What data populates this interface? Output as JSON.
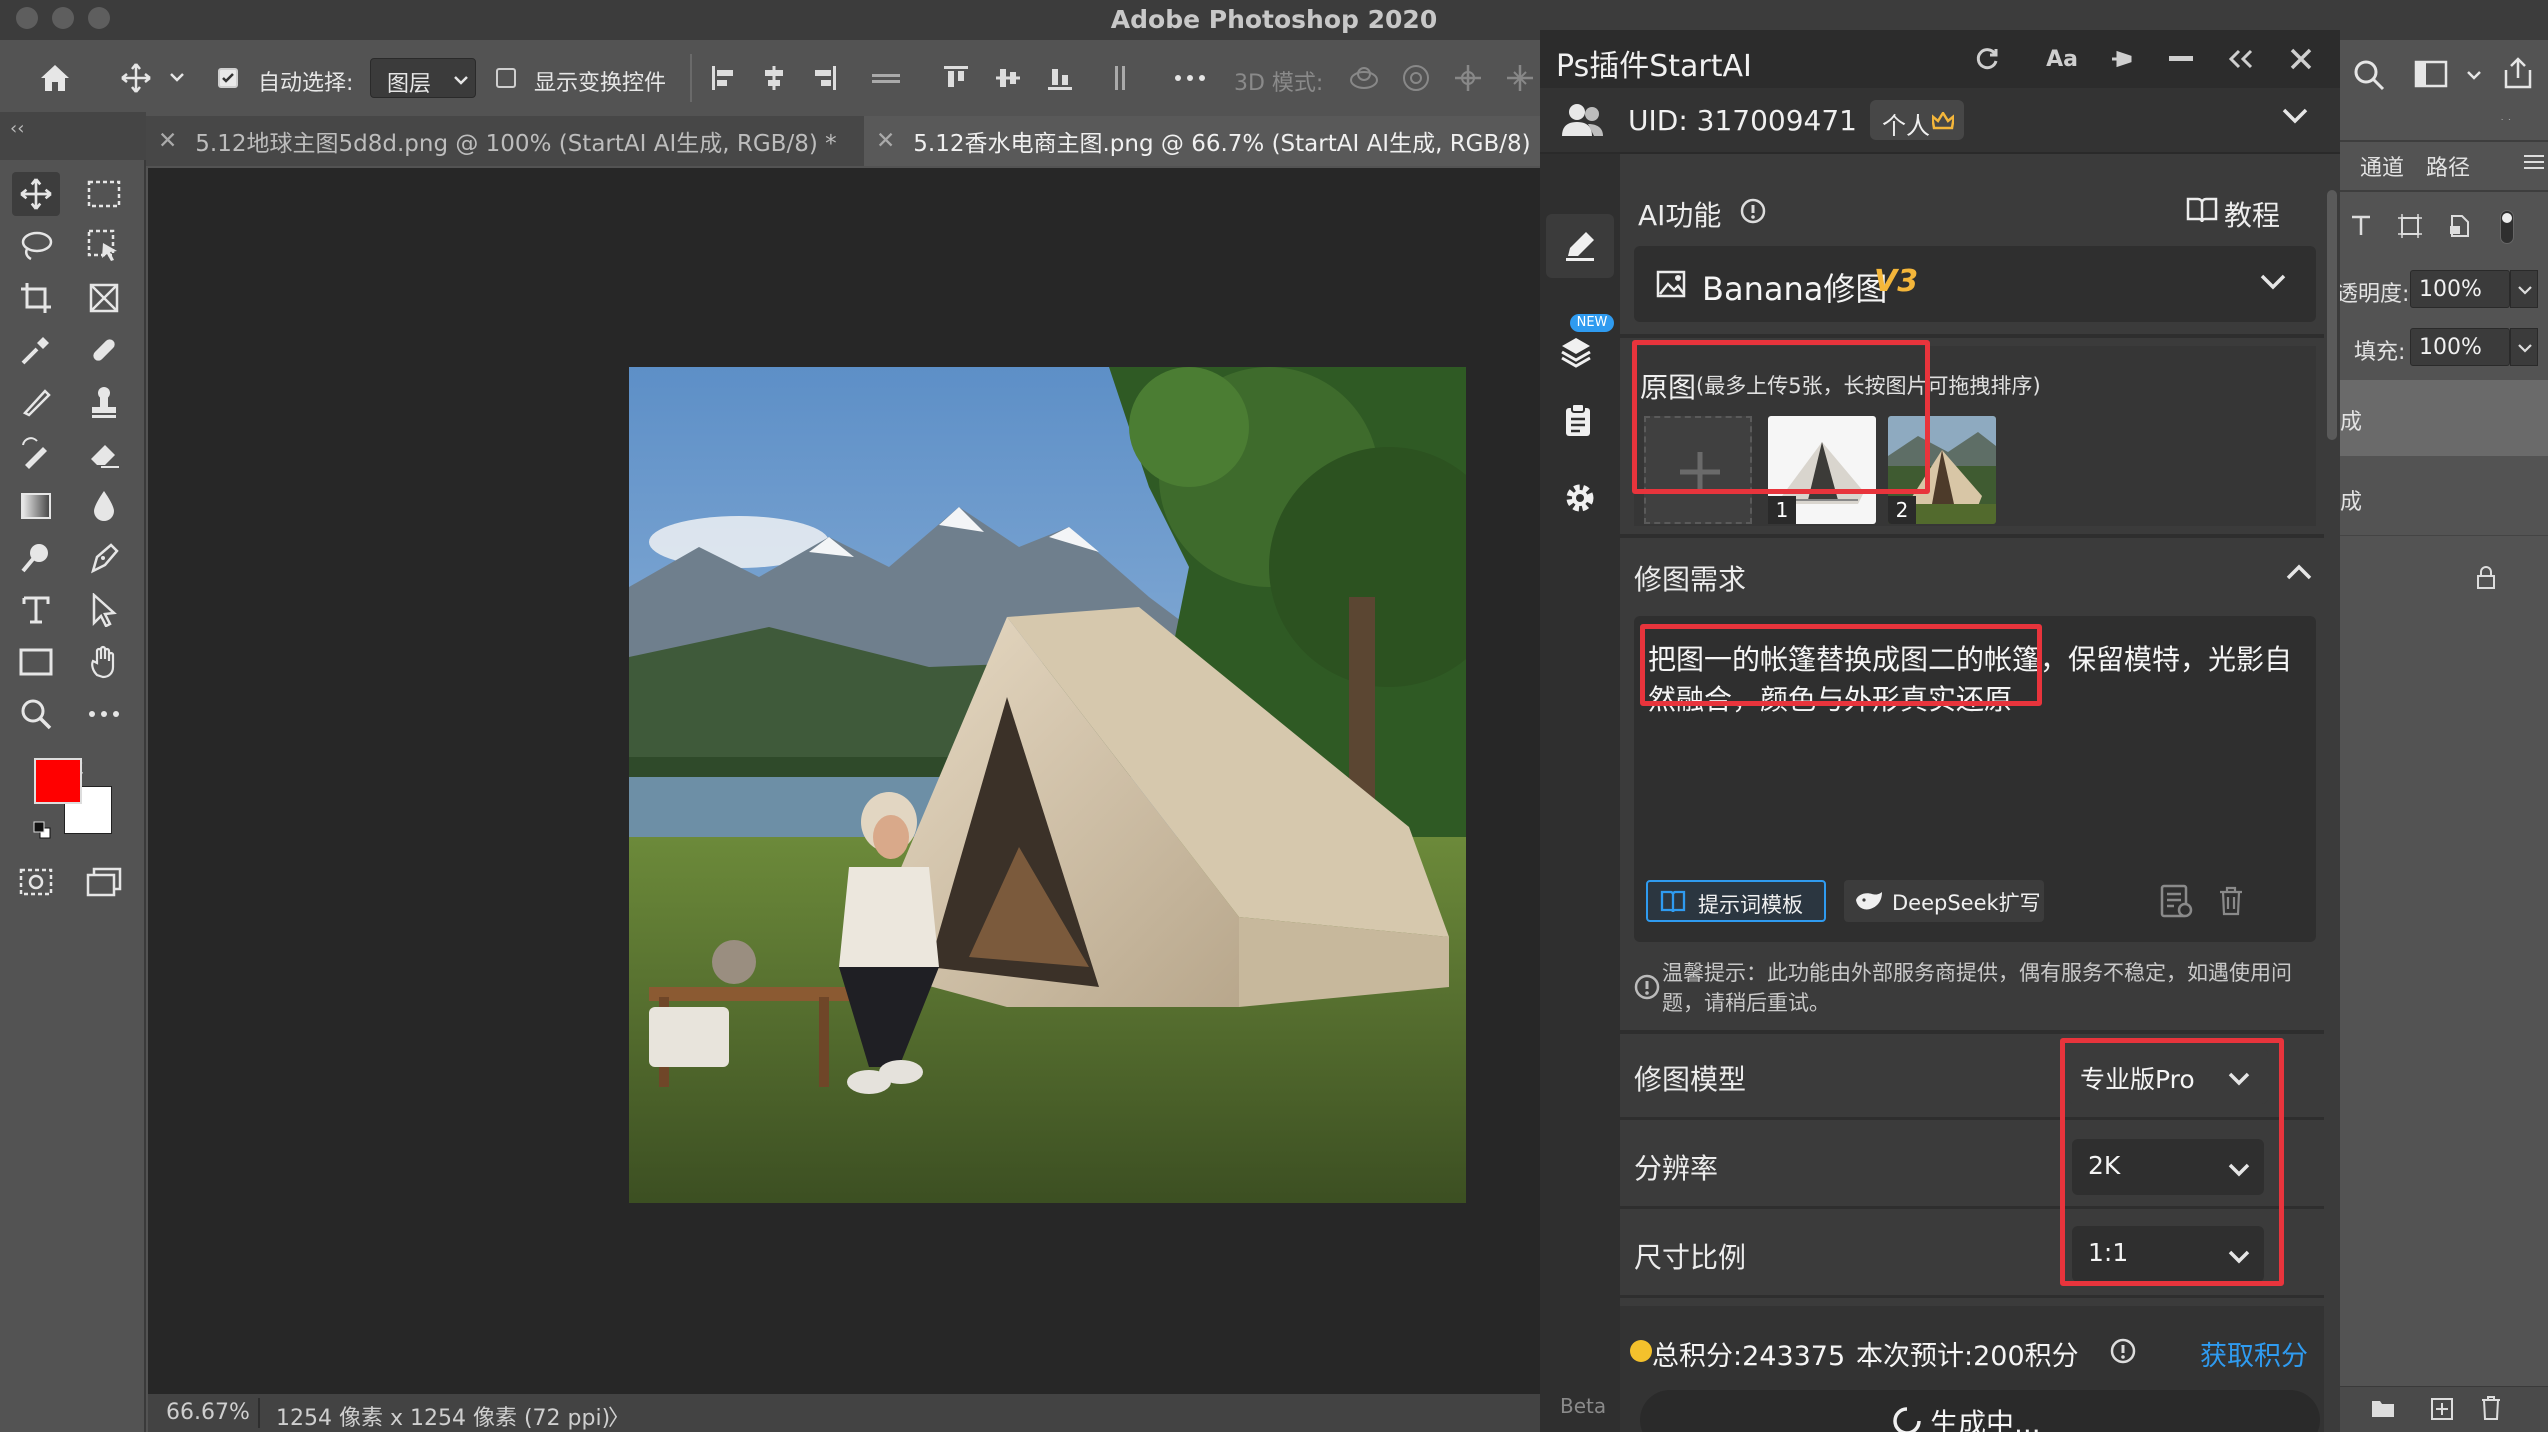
{
  "app": {
    "title": "Adobe Photoshop 2020"
  },
  "options": {
    "auto_select_label": "自动选择:",
    "auto_select_value": "图层",
    "show_transform_label": "显示变换控件",
    "mode_3d_label": "3D 模式:"
  },
  "tabs": [
    {
      "label": "5.12地球主图5d8d.png @ 100% (StartAI AI生成, RGB/8) *"
    },
    {
      "label": "5.12香水电商主图.png @ 66.7% (StartAI AI生成, RGB/8)"
    }
  ],
  "status": {
    "zoom": "66.67%",
    "doc_info": "1254 像素 x 1254 像素 (72 ppi)",
    "arrow": "〉"
  },
  "colors": {
    "foreground": "#ff0000",
    "background": "#ffffff",
    "highlight": "#e8343c",
    "accent": "#2f9bf0",
    "panel_bg": "#3b3b3b"
  },
  "plugin": {
    "title": "Ps插件StartAI",
    "font_btn": "Aa",
    "uid": "UID: 317009471",
    "plan": "个人",
    "beta": "Beta",
    "new_badge": "NEW",
    "ai_func_label": "AI功能",
    "tutorial": "教程",
    "model_name": "Banana修图",
    "model_version": "V3",
    "upload": {
      "title": "原图",
      "hint": "(最多上传5张，长按图片可拖拽排序)",
      "thumbs": [
        {
          "num": "1"
        },
        {
          "num": "2"
        }
      ]
    },
    "edit_req_label": "修图需求",
    "prompt": "把图一的帐篷替换成图二的帐篷，保留模特，光影自然融合，颜色与外形真实还原",
    "prompt_template_btn": "提示词模板",
    "deepseek_btn": "DeepSeek扩写",
    "notice": "温馨提示：此功能由外部服务商提供，偶有服务不稳定，如遇使用问题，请稍后重试。",
    "settings": [
      {
        "label": "修图模型",
        "value": "专业版Pro"
      },
      {
        "label": "分辨率",
        "value": "2K"
      },
      {
        "label": "尺寸比例",
        "value": "1:1"
      }
    ],
    "points": "总积分:243375",
    "estimate": "本次预计:200积分",
    "get_points": "获取积分",
    "generate_btn": "生成中..."
  },
  "right_panel": {
    "tab_channels": "通道",
    "tab_paths": "路径",
    "opacity_label": "透明度:",
    "opacity_value": "100%",
    "fill_label": "填充:",
    "fill_value": "100%",
    "layer1": "成",
    "layer2": "成"
  }
}
